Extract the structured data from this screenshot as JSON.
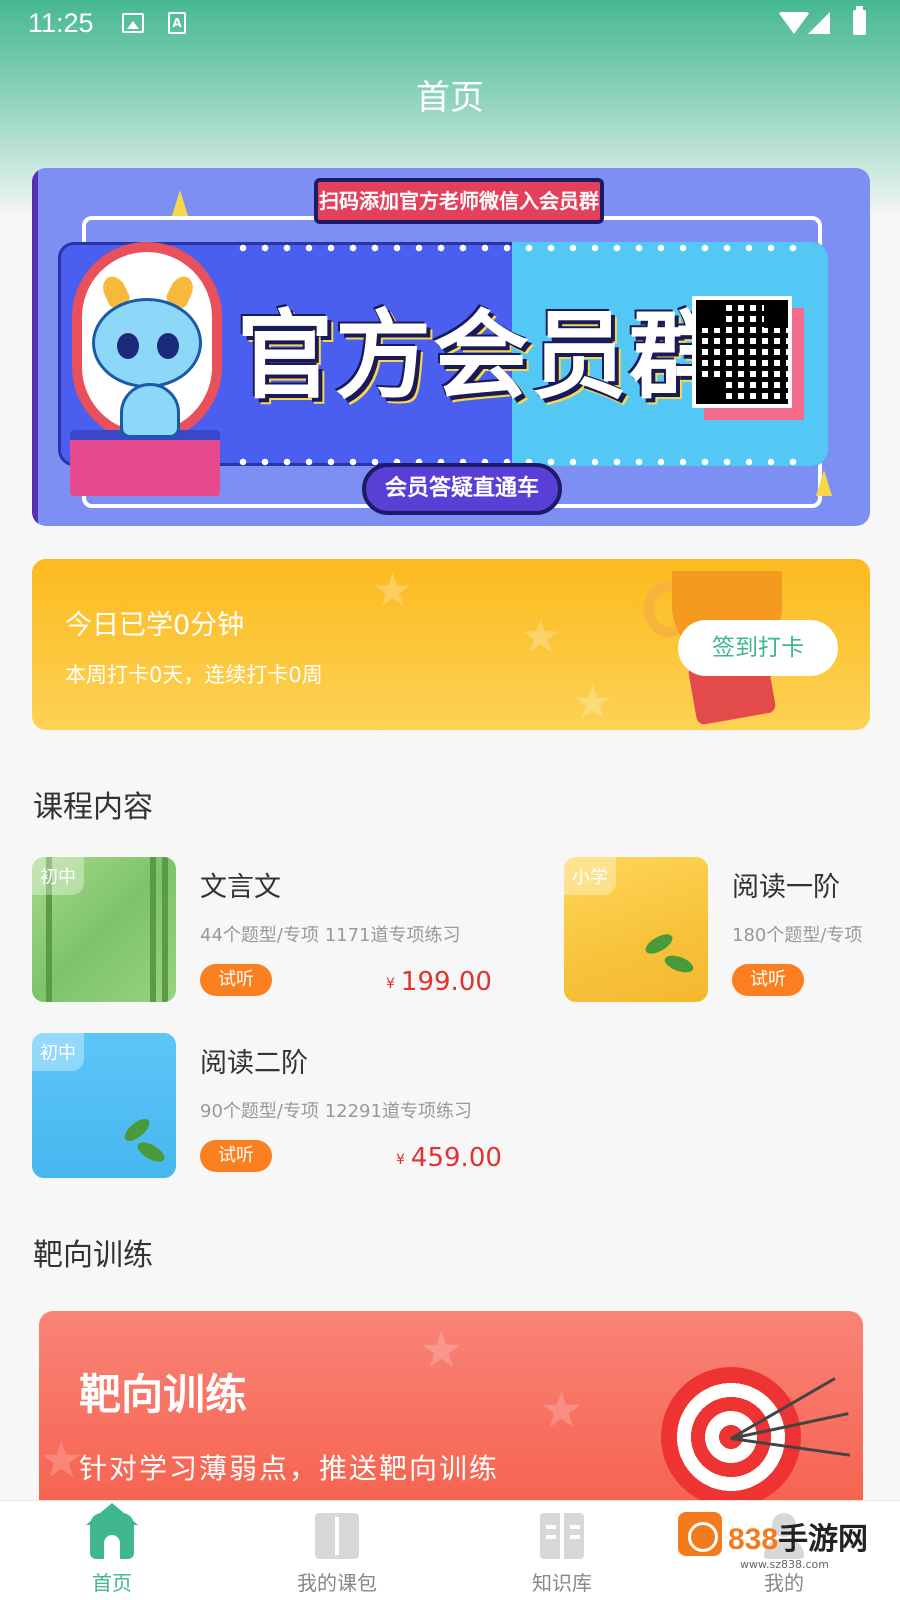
{
  "status_bar": {
    "time": "11:25"
  },
  "page": {
    "title": "首页"
  },
  "banner": {
    "top_label": "扫码添加官方老师微信入会员群",
    "main_text": "官方会员群",
    "bottom_label": "会员答疑直通车"
  },
  "checkin": {
    "title": "今日已学0分钟",
    "subtitle": "本周打卡0天，连续打卡0周",
    "button": "签到打卡"
  },
  "courses_section": {
    "title": "课程内容",
    "items": [
      {
        "tag": "初中",
        "name": "文言文",
        "meta": "44个题型/专项  1171道专项练习",
        "trial": "试听",
        "currency": "¥",
        "price": "199.00"
      },
      {
        "tag": "小学",
        "name": "阅读一阶",
        "meta": "180个题型/专项",
        "trial": "试听"
      },
      {
        "tag": "初中",
        "name": "阅读二阶",
        "meta": "90个题型/专项  12291道专项练习",
        "trial": "试听",
        "currency": "¥",
        "price": "459.00"
      }
    ]
  },
  "target_section": {
    "title": "靶向训练",
    "card_title": "靶向训练",
    "card_subtitle": "针对学习薄弱点，推送靶向训练"
  },
  "tabbar": {
    "items": [
      {
        "label": "首页",
        "icon": "home-icon",
        "active": true
      },
      {
        "label": "我的课包",
        "icon": "book-icon",
        "active": false
      },
      {
        "label": "知识库",
        "icon": "knowledge-icon",
        "active": false
      },
      {
        "label": "我的",
        "icon": "profile-icon",
        "active": false
      }
    ]
  },
  "watermark": {
    "brand_num": "838",
    "brand_cn": "手游网",
    "url": "www.sz838.com"
  },
  "colors": {
    "primary": "#3fb68c",
    "price": "#e0332f",
    "trial": "#fb7f1e"
  }
}
